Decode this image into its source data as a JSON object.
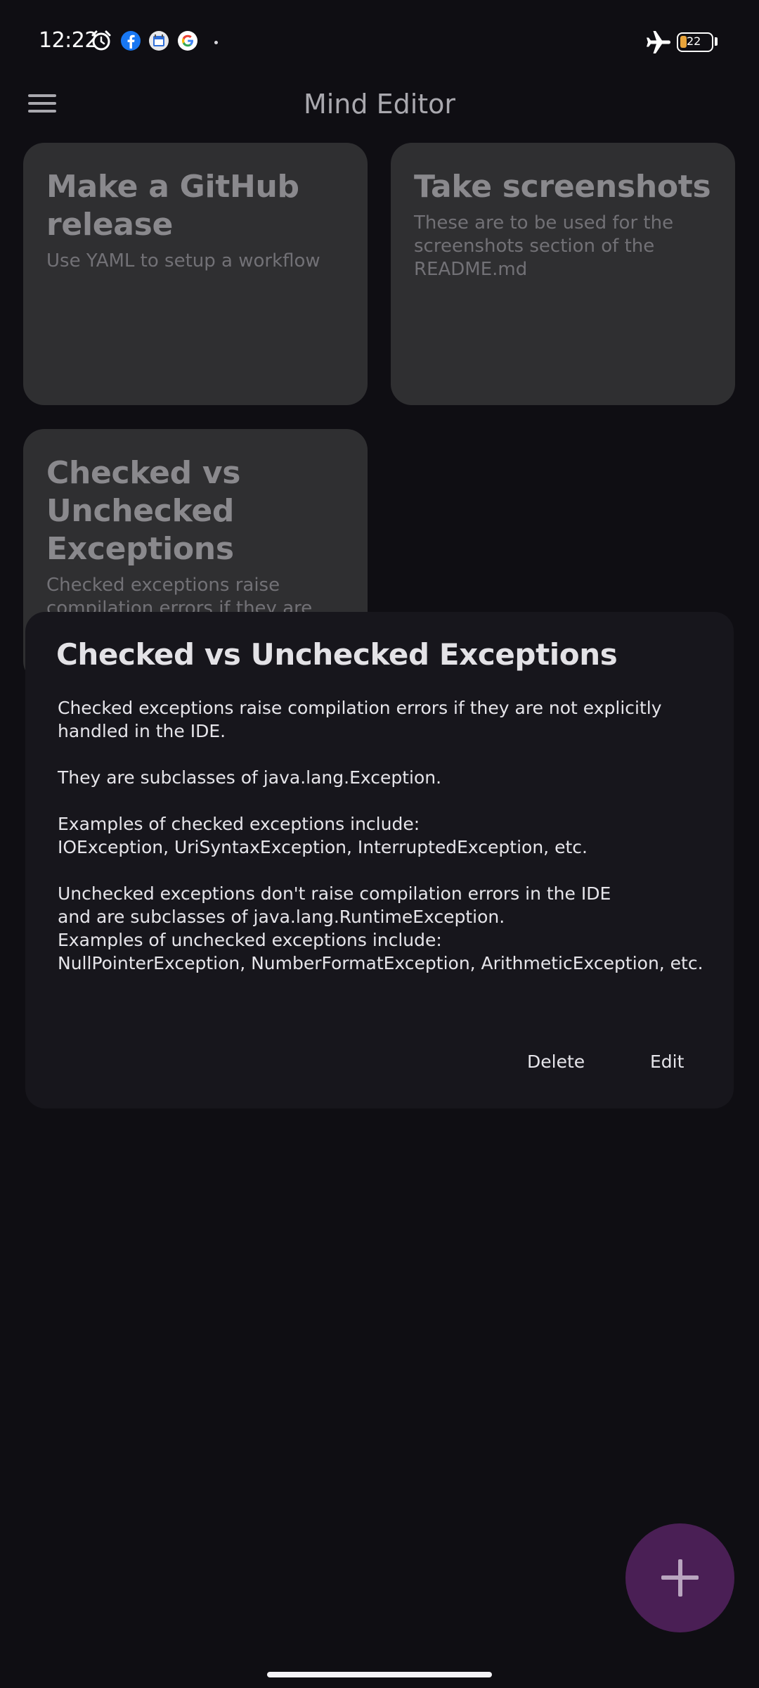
{
  "status_bar": {
    "time": "12:22",
    "battery_level": "22",
    "icons": [
      "alarm-icon",
      "facebook-icon",
      "calendar-app-icon",
      "google-icon",
      "airplane-mode-icon",
      "battery-icon"
    ]
  },
  "app_bar": {
    "title": "Mind Editor",
    "menu_icon": "hamburger-menu-icon"
  },
  "notes": [
    {
      "title": "Make a GitHub release",
      "body": "Use YAML to setup a workflow"
    },
    {
      "title": "Take screenshots",
      "body": "These are to be used for the screenshots section of the README.md"
    },
    {
      "title": "Checked vs Unchecked Exceptions",
      "body": "Checked exceptions raise compilation errors if they are not"
    }
  ],
  "dialog": {
    "title": "Checked vs Unchecked Exceptions",
    "body": "Checked exceptions raise compilation errors if they are not explicitly\nhandled in the IDE.\n\nThey are subclasses of java.lang.Exception.\n\nExamples of checked exceptions include:\nIOException, UriSyntaxException, InterruptedException, etc.\n\nUnchecked exceptions don't raise compilation errors in the IDE\nand are subclasses of java.lang.RuntimeException.\nExamples of unchecked exceptions include:\nNullPointerException, NumberFormatException, ArithmeticException, etc.",
    "delete_label": "Delete",
    "edit_label": "Edit"
  },
  "fab": {
    "icon": "plus-icon"
  },
  "colors": {
    "background": "#0f0e13",
    "card": "#2f2f31",
    "dialog": "#17161c",
    "fab": "#4a1f55",
    "battery_accent": "#e9a43a"
  }
}
